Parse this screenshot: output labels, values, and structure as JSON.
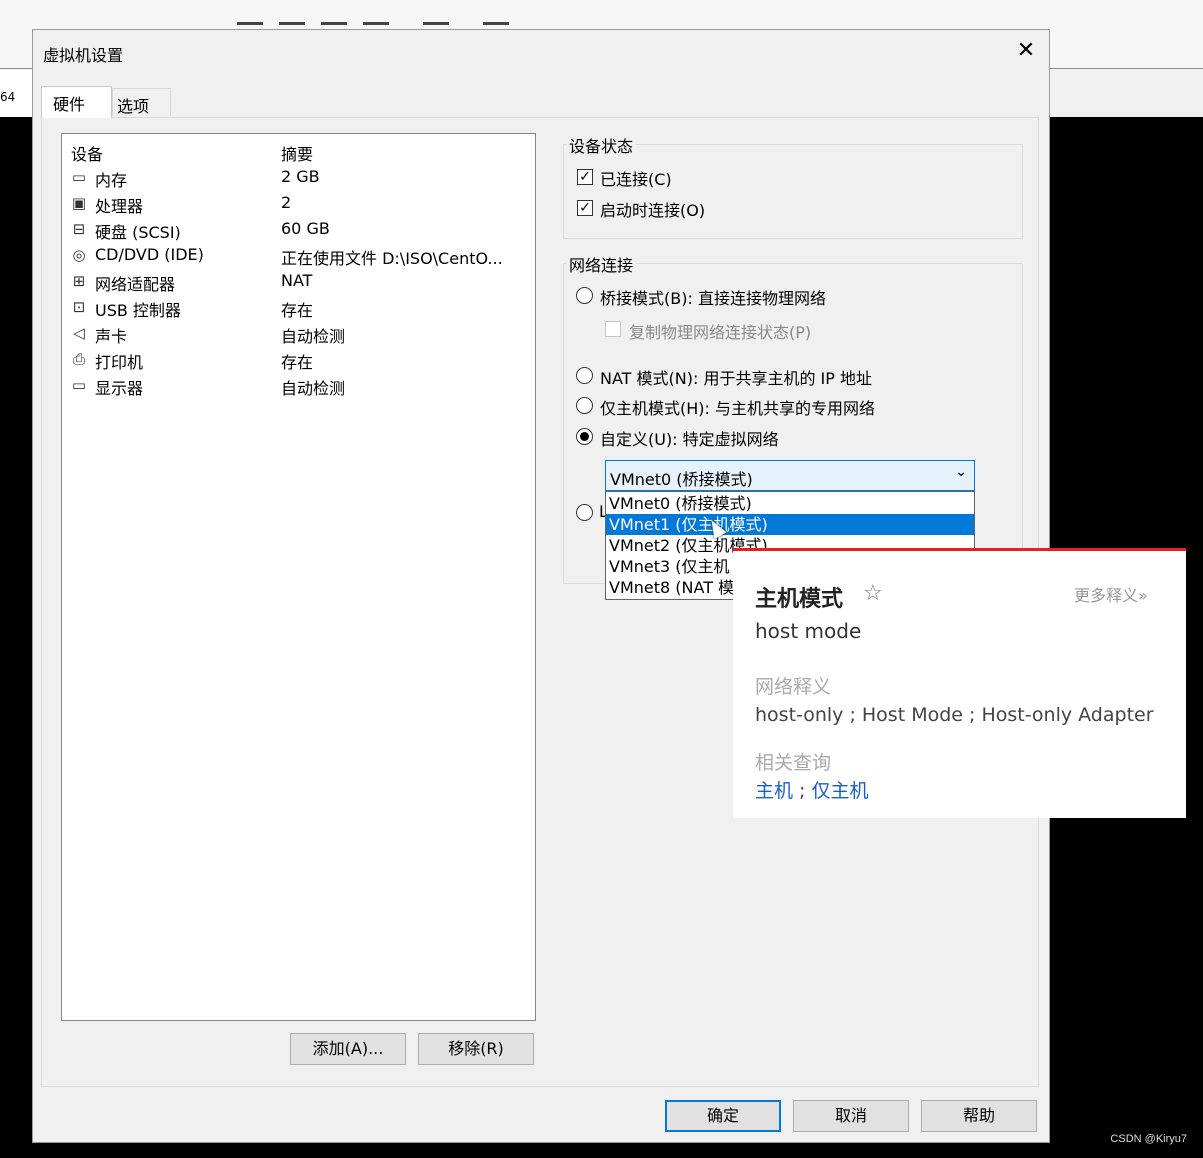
{
  "background": {
    "side_label": "64",
    "watermark": "CSDN @Kiryu7"
  },
  "dialog": {
    "title": "虚拟机设置",
    "close_glyph": "✕"
  },
  "tabs": [
    {
      "label": "硬件"
    },
    {
      "label": "选项"
    }
  ],
  "device_list": {
    "headers": {
      "device": "设备",
      "summary": "摘要"
    },
    "rows": [
      {
        "icon": "memory-icon",
        "name": "内存",
        "summary": "2 GB"
      },
      {
        "icon": "processor-icon",
        "name": "处理器",
        "summary": "2"
      },
      {
        "icon": "hard-disk-icon",
        "name": "硬盘 (SCSI)",
        "summary": "60 GB"
      },
      {
        "icon": "cd-dvd-icon",
        "name": "CD/DVD (IDE)",
        "summary": "正在使用文件 D:\\ISO\\CentO..."
      },
      {
        "icon": "network-adapter-icon",
        "name": "网络适配器",
        "summary": "NAT"
      },
      {
        "icon": "usb-controller-icon",
        "name": "USB 控制器",
        "summary": "存在"
      },
      {
        "icon": "sound-card-icon",
        "name": "声卡",
        "summary": "自动检测"
      },
      {
        "icon": "printer-icon",
        "name": "打印机",
        "summary": "存在"
      },
      {
        "icon": "display-icon",
        "name": "显示器",
        "summary": "自动检测"
      }
    ]
  },
  "buttons": {
    "add": "添加(A)...",
    "remove": "移除(R)",
    "ok": "确定",
    "cancel": "取消",
    "help": "帮助"
  },
  "device_status": {
    "label": "设备状态",
    "connected": {
      "label": "已连接(C)",
      "checked": true
    },
    "connect_at_power_on": {
      "label": "启动时连接(O)",
      "checked": true
    }
  },
  "network_connection": {
    "label": "网络连接",
    "bridged": {
      "label": "桥接模式(B): 直接连接物理网络",
      "selected": false
    },
    "replicate_state": {
      "label": "复制物理网络连接状态(P)",
      "checked": false,
      "enabled": false
    },
    "nat": {
      "label": "NAT 模式(N): 用于共享主机的 IP 地址",
      "selected": false
    },
    "host_only": {
      "label": "仅主机模式(H): 与主机共享的专用网络",
      "selected": false
    },
    "custom": {
      "label": "自定义(U): 特定虚拟网络",
      "selected": true
    },
    "lan_segment_partial": "L",
    "combo_value": "VMnet0 (桥接模式)",
    "combo_arrow": "⌄",
    "dropdown_options": [
      {
        "label": "VMnet0 (桥接模式)",
        "highlighted": false
      },
      {
        "label": "VMnet1 (仅主机模式)",
        "highlighted": true
      },
      {
        "label": "VMnet2 (仅主机模式)",
        "highlighted": false
      },
      {
        "label": "VMnet3 (仅主机",
        "highlighted": false
      },
      {
        "label": "VMnet8 (NAT 模",
        "highlighted": false
      }
    ]
  },
  "dictionary_popup": {
    "word": "主机模式",
    "star": "☆",
    "more": "更多释义»",
    "translation": "host mode",
    "web_label": "网络释义",
    "web_meaning": "host-only ; Host Mode ; Host-only Adapter",
    "related_label": "相关查询",
    "related": [
      "主机",
      "仅主机"
    ],
    "related_separator": " ; "
  },
  "colors": {
    "accent": "#0078d7",
    "popup_border": "#e02424",
    "link": "#1a5ec9"
  }
}
